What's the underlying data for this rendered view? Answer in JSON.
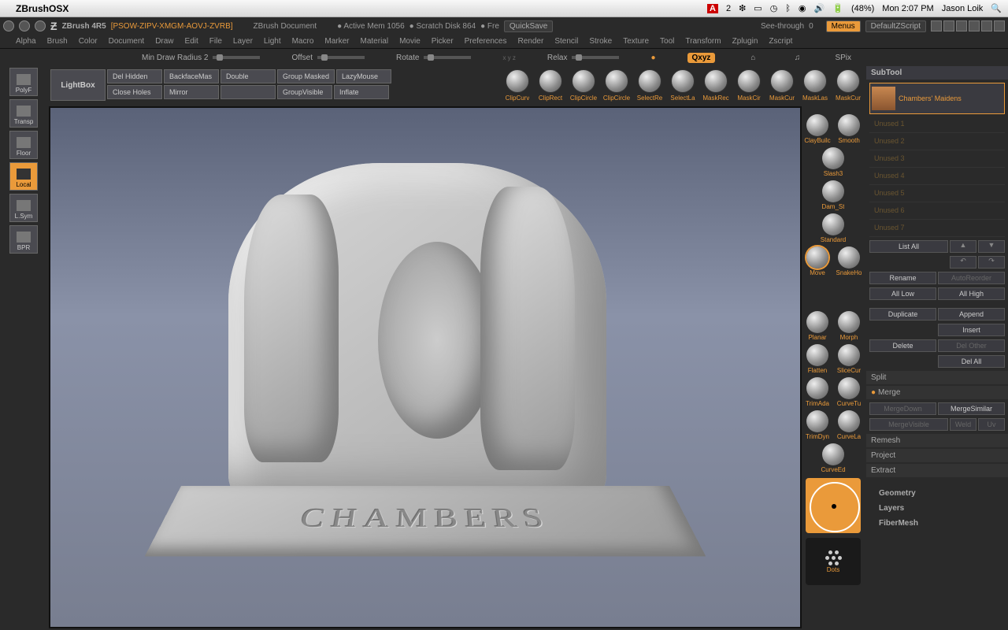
{
  "mac": {
    "app_name": "ZBrushOSX",
    "right": {
      "adobe": "2",
      "battery": "(48%)",
      "day_time": "Mon 2:07 PM",
      "user": "Jason Loik"
    }
  },
  "titlebar": {
    "version": "ZBrush 4R5",
    "project": "[PSOW-ZIPV-XMGM-AOVJ-ZVRB]",
    "doc": "ZBrush Document",
    "mem": "Active Mem 1056",
    "scratch": "Scratch Disk 864",
    "free": "Fre",
    "quicksave": "QuickSave",
    "seethrough": "See-through",
    "seethrough_val": "0",
    "menus": "Menus",
    "zscript": "DefaultZScript"
  },
  "main_menu": [
    "Alpha",
    "Brush",
    "Color",
    "Document",
    "Draw",
    "Edit",
    "File",
    "Layer",
    "Light",
    "Macro",
    "Marker",
    "Material",
    "Movie",
    "Picker",
    "Preferences",
    "Render",
    "Stencil",
    "Stroke",
    "Texture",
    "Tool",
    "Transform",
    "Zplugin",
    "Zscript"
  ],
  "sliders": {
    "min_draw": "Min Draw Radius 2",
    "offset": "Offset",
    "rotate": "Rotate",
    "relax": "Relax",
    "xyz": "Qxyz",
    "spix": "SPix"
  },
  "left_tools": [
    {
      "label": "PolyF",
      "active": false
    },
    {
      "label": "Transp",
      "active": false
    },
    {
      "label": "Floor",
      "active": false
    },
    {
      "label": "Local",
      "active": true
    },
    {
      "label": "L.Sym",
      "active": false
    },
    {
      "label": "BPR",
      "active": false
    }
  ],
  "btnbar": {
    "lightbox": "LightBox",
    "row1": [
      "Del Hidden",
      "BackfaceMas",
      "Double",
      "Group Masked",
      "LazyMouse"
    ],
    "row2": [
      "Close Holes",
      "Mirror",
      "",
      "GroupVisible",
      "Inflate"
    ]
  },
  "top_brushes": [
    "ClipCurv",
    "ClipRect",
    "ClipCircle",
    "ClipCircle",
    "SelectRe",
    "SelectLa",
    "MaskRec",
    "MaskCir",
    "MaskCur",
    "MaskLas",
    "MaskCur"
  ],
  "right_brushes": [
    [
      "ClayBuilc",
      "Smooth"
    ],
    [
      "Slash3",
      ""
    ],
    [
      "Dam_St",
      ""
    ],
    [
      "Standard",
      ""
    ],
    [
      "Move",
      "SnakeHo"
    ],
    [
      "",
      ""
    ],
    [
      "Planar",
      "Morph"
    ],
    [
      "Flatten",
      "SliceCur"
    ],
    [
      "TrimAda",
      "CurveTu"
    ],
    [
      "TrimDyn",
      "CurveLa"
    ],
    [
      "",
      "CurveEd"
    ]
  ],
  "dots_label": "Dots",
  "sculpt_text": "CHAMBERS",
  "right_panel": {
    "subtool_header": "SubTool",
    "subtool_name": "Chambers' Maidens",
    "unused": [
      "Unused 1",
      "Unused 2",
      "Unused 3",
      "Unused 4",
      "Unused 5",
      "Unused 6",
      "Unused 7"
    ],
    "list_all": "List All",
    "rename": "Rename",
    "autoreorder": "AutoReorder",
    "all_low": "All Low",
    "all_high": "All High",
    "duplicate": "Duplicate",
    "append": "Append",
    "insert": "Insert",
    "delete": "Delete",
    "del_other": "Del Other",
    "del_all": "Del All",
    "split": "Split",
    "merge": "Merge",
    "mergedown": "MergeDown",
    "mergesimilar": "MergeSimilar",
    "mergevisible": "MergeVisible",
    "weld": "Weld",
    "uv": "Uv",
    "remesh": "Remesh",
    "project": "Project",
    "extract": "Extract",
    "geometry": "Geometry",
    "layers": "Layers",
    "fibermesh": "FiberMesh"
  }
}
